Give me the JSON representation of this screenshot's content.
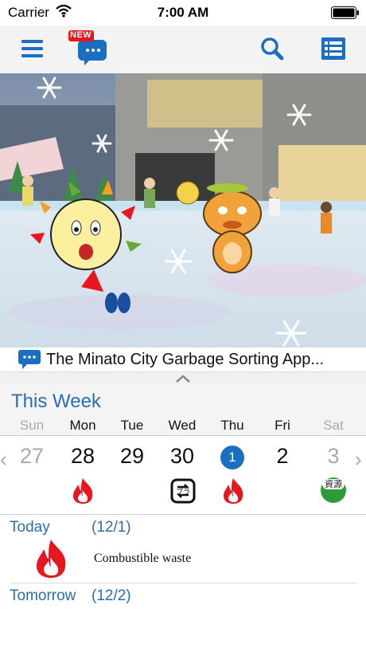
{
  "status_bar": {
    "carrier": "Carrier",
    "time": "7:00 AM"
  },
  "nav": {
    "new_badge": "NEW"
  },
  "banner": {
    "caption": "The Minato City Garbage Sorting App..."
  },
  "week": {
    "title": "This Week",
    "days": [
      {
        "name": "Sun",
        "num": "27",
        "dim": true,
        "icon": ""
      },
      {
        "name": "Mon",
        "num": "28",
        "dim": false,
        "icon": "fire-icon"
      },
      {
        "name": "Tue",
        "num": "29",
        "dim": false,
        "icon": ""
      },
      {
        "name": "Wed",
        "num": "30",
        "dim": false,
        "icon": "recycle-icon"
      },
      {
        "name": "Thu",
        "num": "1",
        "dim": false,
        "icon": "fire-icon",
        "today": true
      },
      {
        "name": "Fri",
        "num": "2",
        "dim": false,
        "icon": ""
      },
      {
        "name": "Sat",
        "num": "3",
        "dim": true,
        "icon": "resource-icon"
      }
    ],
    "resource_glyph": "資源"
  },
  "today": {
    "label": "Today",
    "date": "(12/1)",
    "waste": "Combustible waste"
  },
  "tomorrow": {
    "label": "Tomorrow",
    "date": "(12/2)"
  },
  "colors": {
    "accent": "#2b6db3",
    "fire": "#e8161e",
    "today_circle": "#1a6fc1"
  }
}
